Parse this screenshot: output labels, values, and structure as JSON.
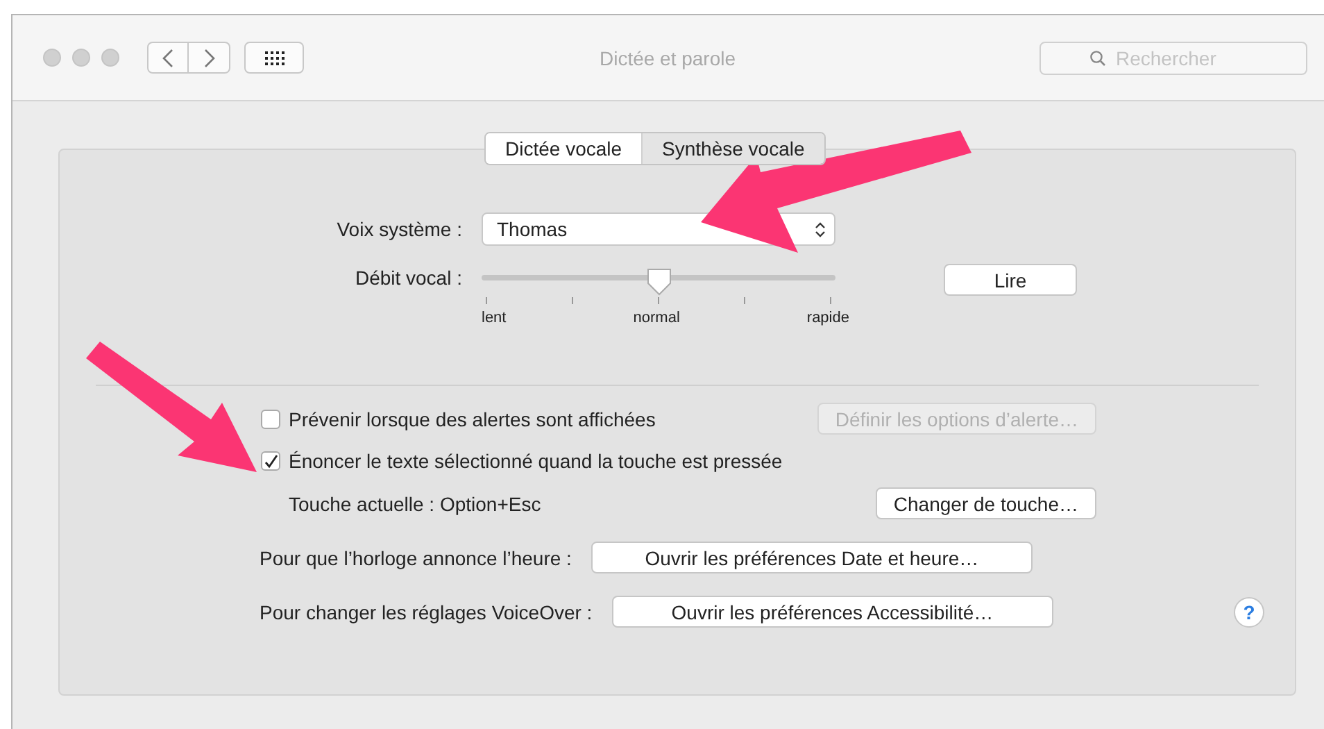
{
  "window": {
    "title": "Dictée et parole"
  },
  "search": {
    "placeholder": "Rechercher"
  },
  "tabs": [
    {
      "label": "Dictée vocale",
      "selected": false
    },
    {
      "label": "Synthèse vocale",
      "selected": true
    }
  ],
  "voice": {
    "label": "Voix système :",
    "value": "Thomas"
  },
  "rate": {
    "label": "Débit vocal :",
    "level": 0.5,
    "ticks": [
      "lent",
      "normal",
      "rapide"
    ],
    "button": "Lire"
  },
  "options": [
    {
      "kind": "checkbox",
      "label": "Prévenir lorsque des alertes sont affichées",
      "checked": false,
      "button": {
        "label": "Définir les options d’alerte…",
        "disabled": true
      }
    },
    {
      "kind": "checkbox",
      "label": "Énoncer le texte sélectionné quand la touche est pressée",
      "checked": true
    },
    {
      "kind": "text",
      "label": "Touche actuelle : Option+Esc",
      "button": {
        "label": "Changer de touche…",
        "disabled": false
      }
    }
  ],
  "links": [
    {
      "label": "Pour que l’horloge annonce l’heure :",
      "button": "Ouvrir les préférences Date et heure…"
    },
    {
      "label": "Pour changer les réglages VoiceOver :",
      "button": "Ouvrir les préférences Accessibilité…"
    }
  ],
  "help": "?"
}
